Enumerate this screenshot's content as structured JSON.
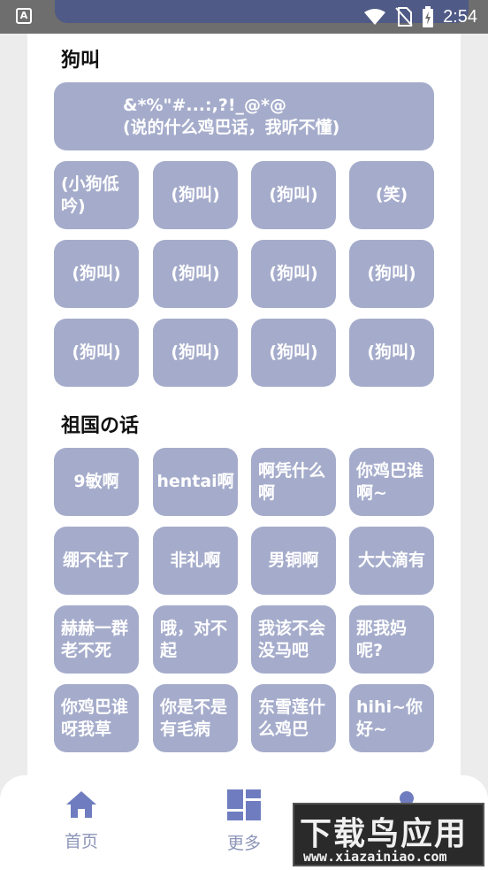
{
  "status_bar": {
    "app_icon": "A",
    "time": "2:54",
    "icons": [
      "wifi-icon",
      "no-sim-icon",
      "battery-charging-icon"
    ]
  },
  "sections": [
    {
      "title": "狗叫",
      "wide_button": {
        "line1": "&*%\"#...:,?!_@*@",
        "line2": "(说的什么鸡巴话，我听不懂)"
      },
      "rows": [
        [
          "(小狗低吟)",
          "(狗叫)",
          "(狗叫)",
          "(笑)"
        ],
        [
          "(狗叫)",
          "(狗叫)",
          "(狗叫)",
          "(狗叫)"
        ],
        [
          "(狗叫)",
          "(狗叫)",
          "(狗叫)",
          "(狗叫)"
        ]
      ]
    },
    {
      "title": "祖国の话",
      "rows": [
        [
          "9敏啊",
          "hentai啊",
          "啊凭什么啊",
          "你鸡巴谁啊~"
        ],
        [
          "绷不住了",
          "非礼啊",
          "男铜啊",
          "大大滴有"
        ],
        [
          "赫赫一群老不死",
          "哦，对不起",
          "我该不会没马吧",
          "那我妈呢?"
        ],
        [
          "你鸡巴谁呀我草",
          "你是不是有毛病",
          "东雪莲什么鸡巴",
          "hihi~你好~"
        ]
      ]
    }
  ],
  "bottom_nav": [
    {
      "label": "首页",
      "icon": "home-icon"
    },
    {
      "label": "更多",
      "icon": "grid-icon"
    },
    {
      "label": "",
      "icon": "profile-icon"
    }
  ],
  "watermark": {
    "title": "下载鸟应用",
    "url": "www.xiazainiao.com"
  },
  "colors": {
    "button": "#a5accb",
    "nav_label": "#8c95b8",
    "status_pill": "#4f5a86"
  }
}
